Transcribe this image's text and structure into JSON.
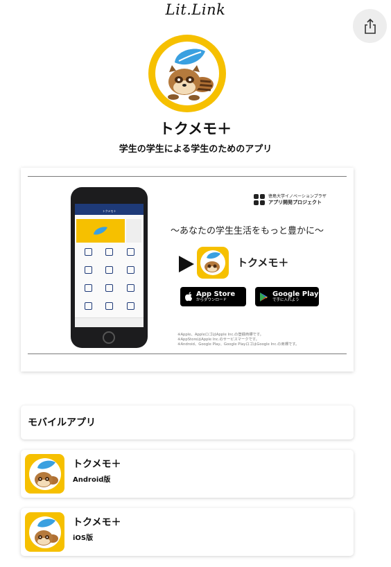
{
  "site": {
    "logo_text": "Lit.Link",
    "share_icon": "share-icon"
  },
  "profile": {
    "name": "トクメモ＋",
    "description": "学生の学生による学生のためのアプリ",
    "avatar_icon": "tanuki-leaf-icon",
    "colors": {
      "accent": "#f6c000",
      "leaf": "#3aa0e0",
      "phone_header": "#1e3a78"
    }
  },
  "banner": {
    "project_org": "徳島大学イノベーションプラザ",
    "project_name": "アプリ開発プロジェクト",
    "tagline": "〜あなたの学生生活をもっと豊かに〜",
    "app_name": "トクメモ＋",
    "phone_header_title": "トクメモ＋",
    "app_store_big": "App Store",
    "app_store_small": "からダウンロード",
    "google_play_big": "Google Play",
    "google_play_small": "で手に入れよう",
    "notes": [
      "※Apple、AppleロゴはApple Inc.の登録商標です。",
      "※AppStoreはApple Inc.のサービスマークです。",
      "※Android、Google Play、Google PlayロゴはGoogle Inc.の商標です。"
    ]
  },
  "section": {
    "title": "モバイルアプリ"
  },
  "links": [
    {
      "name": "トクメモ＋",
      "platform": "Android版"
    },
    {
      "name": "トクメモ＋",
      "platform": "iOS版"
    }
  ]
}
